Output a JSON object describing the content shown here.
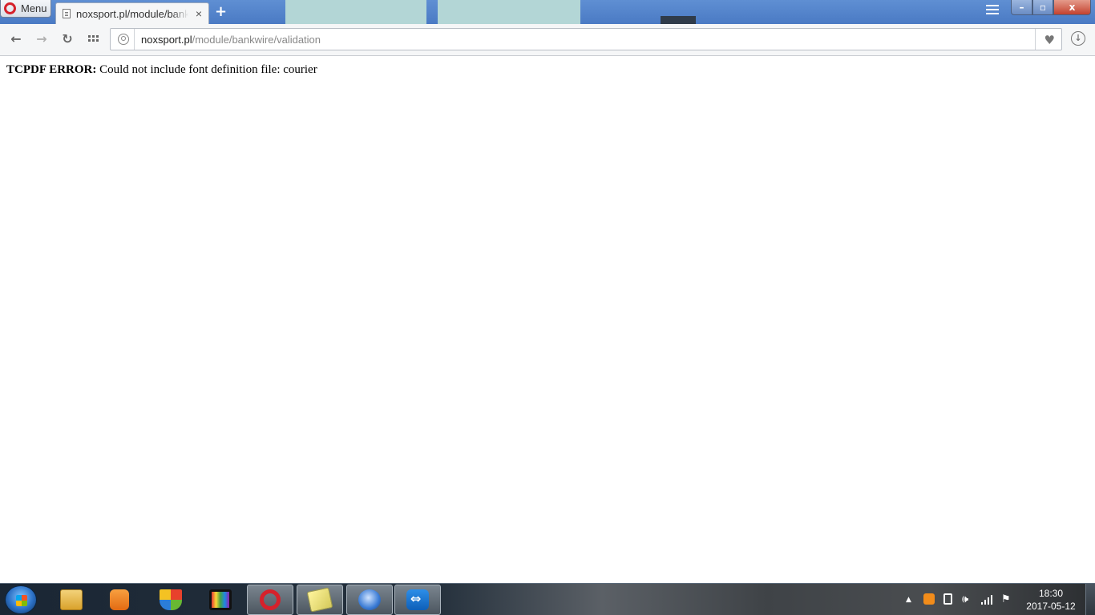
{
  "browser": {
    "menu_label": "Menu",
    "tab_title": "noxsport.pl/module/bankwire/validation",
    "new_tab_glyph": "+",
    "tab_close_glyph": "×",
    "window_controls": {
      "minimize": "–",
      "maximize": "▫",
      "close": "x"
    },
    "toolbar": {
      "back_glyph": "←",
      "forward_glyph": "→",
      "reload_glyph": "↻",
      "url_host": "noxsport.pl",
      "url_path": "/module/bankwire/validation",
      "heart_glyph": "♥",
      "download_glyph": "↓"
    }
  },
  "page": {
    "error_label": "TCPDF ERROR:",
    "error_message": " Could not include font definition file: courier"
  },
  "taskbar": {
    "apps": [
      {
        "name": "explorer-icon"
      },
      {
        "name": "media-player-icon"
      },
      {
        "name": "defender-icon"
      },
      {
        "name": "film-icon"
      },
      {
        "name": "opera-icon"
      },
      {
        "name": "sticky-notes-icon"
      },
      {
        "name": "thunderbird-icon"
      },
      {
        "name": "teamviewer-icon"
      }
    ],
    "tray": {
      "expand_glyph": "▲",
      "volume_glyph": "🕪",
      "flag_glyph": "⚑"
    },
    "clock": {
      "time": "18:30",
      "date": "2017-05-12"
    }
  },
  "colors": {
    "titlebar": "#4a7ac4",
    "opera_red": "#d6212b",
    "toolbar_bg": "#f5f6f7"
  }
}
